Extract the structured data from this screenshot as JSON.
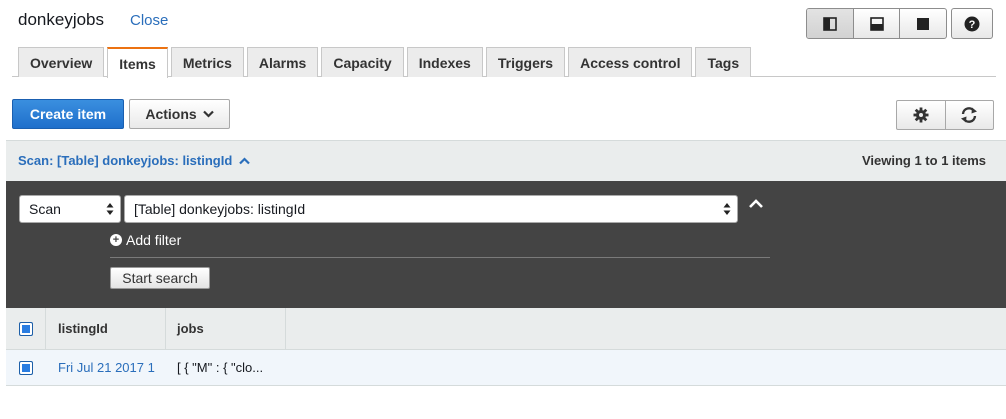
{
  "header": {
    "table_name": "donkeyjobs",
    "close_label": "Close",
    "layout_icons": [
      "split-left-icon",
      "split-bottom-icon",
      "full-panel-icon"
    ],
    "help_icon": "question-circle-icon"
  },
  "tabs": [
    {
      "label": "Overview",
      "active": false
    },
    {
      "label": "Items",
      "active": true
    },
    {
      "label": "Metrics",
      "active": false
    },
    {
      "label": "Alarms",
      "active": false
    },
    {
      "label": "Capacity",
      "active": false
    },
    {
      "label": "Indexes",
      "active": false
    },
    {
      "label": "Triggers",
      "active": false
    },
    {
      "label": "Access control",
      "active": false
    },
    {
      "label": "Tags",
      "active": false
    }
  ],
  "toolbar": {
    "create_label": "Create item",
    "actions_label": "Actions",
    "settings_icon": "gear-icon",
    "refresh_icon": "refresh-icon"
  },
  "scan": {
    "summary": "Scan: [Table] donkeyjobs: listingId",
    "viewing": "Viewing 1 to 1 items",
    "operation": "Scan",
    "target": "[Table] donkeyjobs: listingId",
    "add_filter": "Add filter",
    "start_search": "Start search"
  },
  "grid": {
    "columns": [
      "listingId",
      "jobs"
    ],
    "rows": [
      {
        "listingId": "Fri Jul 21 2017 1",
        "jobs": "[ { \"M\" : { \"clo..."
      }
    ]
  },
  "colors": {
    "primary": "#1f6fcb",
    "link": "#2a6ebb",
    "tab_accent": "#ec7211",
    "panel": "#444444"
  }
}
